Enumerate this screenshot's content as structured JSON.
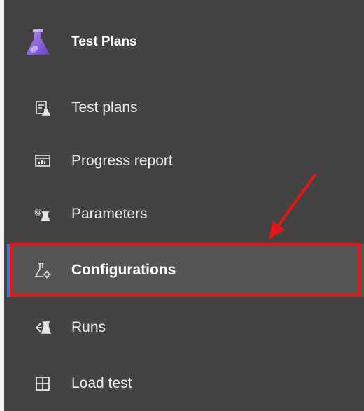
{
  "header": {
    "title": "Test Plans",
    "icon": "flask-icon",
    "accent_color": "#8a63d2"
  },
  "nav": {
    "items": [
      {
        "label": "Test plans",
        "icon": "test-plans-icon"
      },
      {
        "label": "Progress report",
        "icon": "progress-report-icon"
      },
      {
        "label": "Parameters",
        "icon": "parameters-icon"
      },
      {
        "label": "Configurations",
        "icon": "configurations-icon",
        "selected": true
      },
      {
        "label": "Runs",
        "icon": "runs-icon"
      },
      {
        "label": "Load test",
        "icon": "load-test-icon"
      }
    ],
    "selected_indicator_color": "#2c7bd8"
  },
  "annotation": {
    "highlight_color": "#e61616"
  }
}
